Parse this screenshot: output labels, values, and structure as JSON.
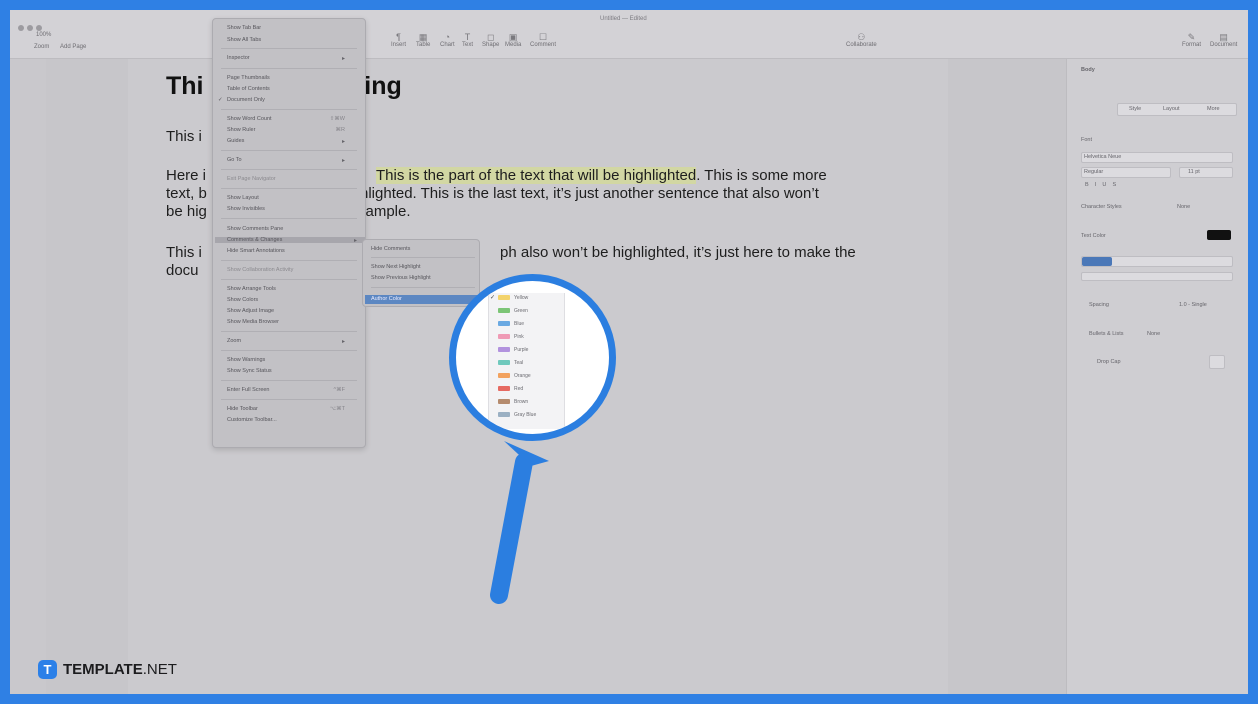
{
  "window": {
    "title": "Untitled — Edited"
  },
  "toolbar": {
    "zoom": "100%",
    "left_items": [
      "Zoom",
      "Add Page"
    ],
    "center_items": [
      "Insert",
      "Table",
      "Chart",
      "Text",
      "Shape",
      "Media",
      "Comment"
    ],
    "collaborate": "Collaborate",
    "right_items": [
      "Format",
      "Document"
    ]
  },
  "document": {
    "heading_left": "Thi",
    "heading_right": "ding",
    "line1": "This i",
    "para2_line1_left": "Here i",
    "para2_highlight": "This is the part of the text that will be highlighted",
    "para2_line1_right": ". This is some more",
    "para2_line2_left": "text, b",
    "para2_line2_right": "nlighted. This is the last text, it’s just another sentence that also won’t",
    "para2_line3_left": "be hig",
    "para2_line3_right": "xample.",
    "para3_line1_left": "This i",
    "para3_line1_right": "ph also won’t be highlighted, it’s just here to make the",
    "para3_line2_left": "docu"
  },
  "view_menu": {
    "items": [
      {
        "label": "Show Tab Bar",
        "shortcut": "",
        "check": false,
        "arrow": false
      },
      {
        "label": "Show All Tabs",
        "shortcut": "",
        "check": false,
        "arrow": false
      },
      {
        "label": "Inspector",
        "shortcut": "",
        "check": false,
        "arrow": true
      },
      {
        "label": "Page Thumbnails",
        "shortcut": "",
        "check": false,
        "arrow": false
      },
      {
        "label": "Table of Contents",
        "shortcut": "",
        "check": false,
        "arrow": false
      },
      {
        "label": "Document Only",
        "shortcut": "",
        "check": true,
        "arrow": false
      },
      {
        "label": "Show Word Count",
        "shortcut": "⇧⌘W",
        "check": false,
        "arrow": false
      },
      {
        "label": "Show Ruler",
        "shortcut": "⌘R",
        "check": false,
        "arrow": false
      },
      {
        "label": "Guides",
        "shortcut": "",
        "check": false,
        "arrow": true
      },
      {
        "label": "Go To",
        "shortcut": "",
        "check": false,
        "arrow": true
      },
      {
        "label": "Exit Page Navigator",
        "shortcut": "",
        "check": false,
        "arrow": false
      },
      {
        "label": "Show Layout",
        "shortcut": "",
        "check": false,
        "arrow": false
      },
      {
        "label": "Show Invisibles",
        "shortcut": "",
        "check": false,
        "arrow": false
      },
      {
        "label": "Show Comments Pane",
        "shortcut": "",
        "check": false,
        "arrow": false
      },
      {
        "label": "Comments & Changes",
        "shortcut": "",
        "check": false,
        "arrow": true
      },
      {
        "label": "Hide Smart Annotations",
        "shortcut": "",
        "check": false,
        "arrow": false
      },
      {
        "label": "Show Collaboration Activity",
        "shortcut": "",
        "check": false,
        "arrow": false
      },
      {
        "label": "Show Arrange Tools",
        "shortcut": "",
        "check": false,
        "arrow": false
      },
      {
        "label": "Show Colors",
        "shortcut": "",
        "check": false,
        "arrow": false
      },
      {
        "label": "Show Adjust Image",
        "shortcut": "",
        "check": false,
        "arrow": false
      },
      {
        "label": "Show Media Browser",
        "shortcut": "",
        "check": false,
        "arrow": false
      },
      {
        "label": "Zoom",
        "shortcut": "",
        "check": false,
        "arrow": true
      },
      {
        "label": "Show Warnings",
        "shortcut": "",
        "check": false,
        "arrow": false
      },
      {
        "label": "Show Sync Status",
        "shortcut": "",
        "check": false,
        "arrow": false
      },
      {
        "label": "Enter Full Screen",
        "shortcut": "^⌘F",
        "check": false,
        "arrow": false
      },
      {
        "label": "Hide Toolbar",
        "shortcut": "⌥⌘T",
        "check": false,
        "arrow": false
      },
      {
        "label": "Customize Toolbar...",
        "shortcut": "",
        "check": false,
        "arrow": false
      }
    ]
  },
  "submenu": {
    "items": [
      "Hide Comments",
      "Show Next Highlight",
      "Show Previous Highlight"
    ],
    "active": "Author Color"
  },
  "color_list": {
    "selected": "Yellow",
    "items": [
      {
        "name": "Yellow",
        "color": "#f3d36b"
      },
      {
        "name": "Green",
        "color": "#7cc576"
      },
      {
        "name": "Blue",
        "color": "#6aa9e2"
      },
      {
        "name": "Pink",
        "color": "#ef9ab5"
      },
      {
        "name": "Purple",
        "color": "#b292de"
      },
      {
        "name": "Teal",
        "color": "#6fc9bd"
      },
      {
        "name": "Orange",
        "color": "#f2a25f"
      },
      {
        "name": "Red",
        "color": "#e66a62"
      },
      {
        "name": "Brown",
        "color": "#b58b6e"
      },
      {
        "name": "Gray Blue",
        "color": "#9bb0c3"
      }
    ]
  },
  "sidebar": {
    "paragraph_style": "Body",
    "tabs": [
      "Style",
      "Layout",
      "More"
    ],
    "font_label": "Font",
    "font_name": "Helvetica Neue",
    "font_style": "Regular",
    "font_size": "11 pt",
    "char_styles_label": "Character Styles",
    "char_styles_value": "None",
    "text_color_label": "Text Color",
    "spacing_label": "Spacing",
    "spacing_value": "1.0 - Single",
    "bullets_label": "Bullets & Lists",
    "bullets_value": "None",
    "dropcap_label": "Drop Cap"
  },
  "watermark": {
    "brand": "TEMPLATE",
    "suffix": ".NET"
  }
}
